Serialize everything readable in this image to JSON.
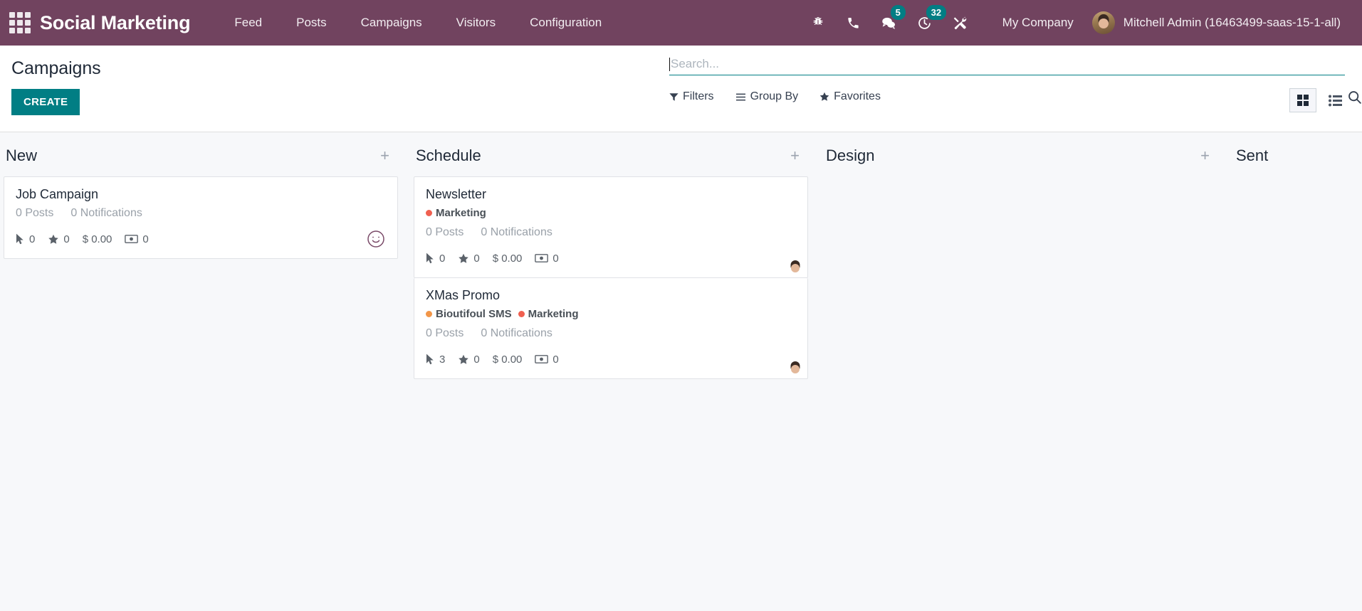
{
  "navbar": {
    "apps_icon": "apps-grid-icon",
    "brand": "Social Marketing",
    "menu": [
      {
        "label": "Feed"
      },
      {
        "label": "Posts"
      },
      {
        "label": "Campaigns"
      },
      {
        "label": "Visitors"
      },
      {
        "label": "Configuration"
      }
    ],
    "sys_icons": [
      {
        "name": "bug-icon",
        "badge": ""
      },
      {
        "name": "phone-icon",
        "badge": ""
      },
      {
        "name": "messages-icon",
        "badge": "5"
      },
      {
        "name": "activities-clock-icon",
        "badge": "32"
      },
      {
        "name": "tools-icon",
        "badge": ""
      }
    ],
    "company": "My Company",
    "user": "Mitchell Admin (16463499-saas-15-1-all)",
    "background_color": "#71435F",
    "badge_color": "#017E84"
  },
  "control_panel": {
    "title": "Campaigns",
    "create_label": "CREATE",
    "create_color": "#017E84",
    "search": {
      "value": "",
      "placeholder": "Search...",
      "icon": "magnifier-icon"
    },
    "filters": [
      {
        "label": "Filters",
        "icon": "funnel-icon"
      },
      {
        "label": "Group By",
        "icon": "hamburger-icon"
      },
      {
        "label": "Favorites",
        "icon": "star-icon"
      }
    ],
    "views": [
      {
        "name": "kanban-view",
        "icon": "grid-icon",
        "active": true
      },
      {
        "name": "list-view",
        "icon": "list-icon",
        "active": false
      }
    ]
  },
  "kanban": {
    "columns": [
      {
        "title": "New",
        "add_icon": "plus-icon",
        "cards": [
          {
            "title": "Job Campaign",
            "tags": [],
            "posts": "0 Posts",
            "notifications": "0 Notifications",
            "clicks": "0",
            "leads": "0",
            "revenue": "$ 0.00",
            "quotations": "0",
            "assignee_icon": "smiley-face-icon",
            "assignee": ""
          }
        ]
      },
      {
        "title": "Schedule",
        "add_icon": "plus-icon",
        "cards": [
          {
            "title": "Newsletter",
            "tags": [
              {
                "label": "Marketing",
                "color": "#F06050"
              }
            ],
            "posts": "0 Posts",
            "notifications": "0 Notifications",
            "clicks": "0",
            "leads": "0",
            "revenue": "$ 0.00",
            "quotations": "0",
            "assignee_icon": "avatar",
            "assignee": "Mitchell Admin"
          },
          {
            "title": "XMas Promo",
            "tags": [
              {
                "label": "Bioutifoul SMS",
                "color": "#F29648"
              },
              {
                "label": "Marketing",
                "color": "#F06050"
              }
            ],
            "posts": "0 Posts",
            "notifications": "0 Notifications",
            "clicks": "3",
            "leads": "0",
            "revenue": "$ 0.00",
            "quotations": "0",
            "assignee_icon": "avatar",
            "assignee": "Mitchell Admin"
          }
        ]
      },
      {
        "title": "Design",
        "add_icon": "plus-icon",
        "cards": []
      },
      {
        "title": "Sent",
        "add_icon": "plus-icon",
        "cards": []
      }
    ]
  }
}
